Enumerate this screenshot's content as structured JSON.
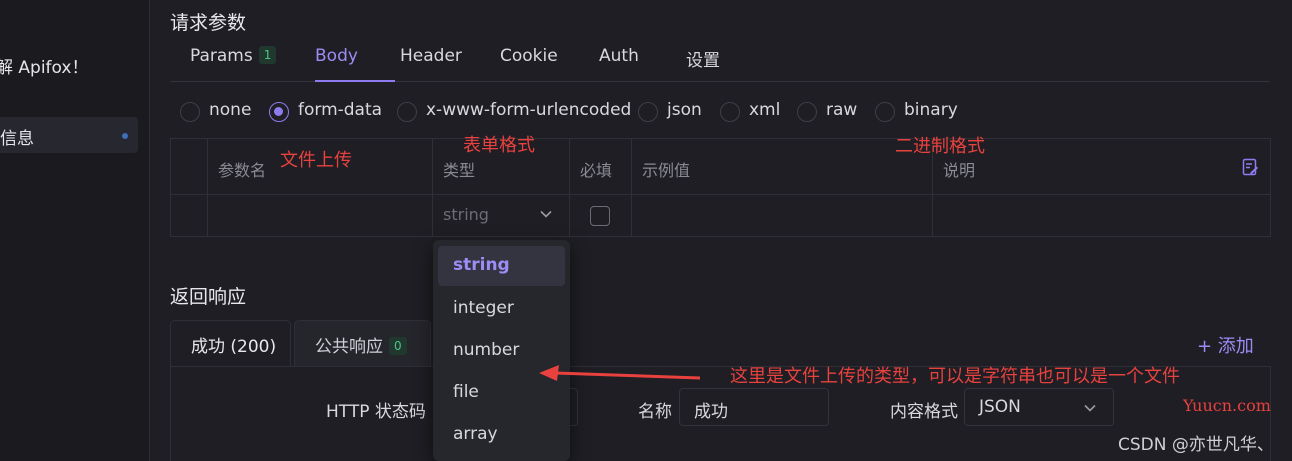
{
  "sidebar": {
    "welcome_text": "解 Apifox！",
    "active_item_label": "信息"
  },
  "request": {
    "section_title": "请求参数",
    "tabs": [
      {
        "label": "Params",
        "badge": "1"
      },
      {
        "label": "Body"
      },
      {
        "label": "Header"
      },
      {
        "label": "Cookie"
      },
      {
        "label": "Auth"
      },
      {
        "label": "设置"
      }
    ],
    "active_tab": "Body",
    "body_types": [
      "none",
      "form-data",
      "x-www-form-urlencoded",
      "json",
      "xml",
      "raw",
      "binary"
    ],
    "selected_body_type": "form-data"
  },
  "param_table": {
    "headers": [
      "参数名",
      "类型",
      "必填",
      "示例值",
      "说明"
    ],
    "row": {
      "type_value": "string"
    }
  },
  "type_dropdown": {
    "options": [
      "string",
      "integer",
      "number",
      "file",
      "array"
    ],
    "selected": "string"
  },
  "response": {
    "section_title": "返回响应",
    "tabs": [
      {
        "label": "成功 (200)"
      },
      {
        "label": "公共响应",
        "badge": "0"
      }
    ],
    "add_label": "+ 添加",
    "http_status_label": "HTTP 状态码",
    "name_label": "名称",
    "name_value": "成功",
    "content_format_label": "内容格式",
    "content_format_value": "JSON"
  },
  "annotations": {
    "file_upload": "文件上传",
    "form_format": "表单格式",
    "binary_format": "二进制格式",
    "note": "这里是文件上传的类型，可以是字符串也可以是一个文件"
  },
  "watermarks": {
    "site": "Yuucn.com",
    "csdn": "CSDN @亦世凡华、"
  },
  "colors": {
    "accent": "#8c7cf0",
    "annotation_red": "#e8413e",
    "badge_green": "#4fc18a"
  }
}
